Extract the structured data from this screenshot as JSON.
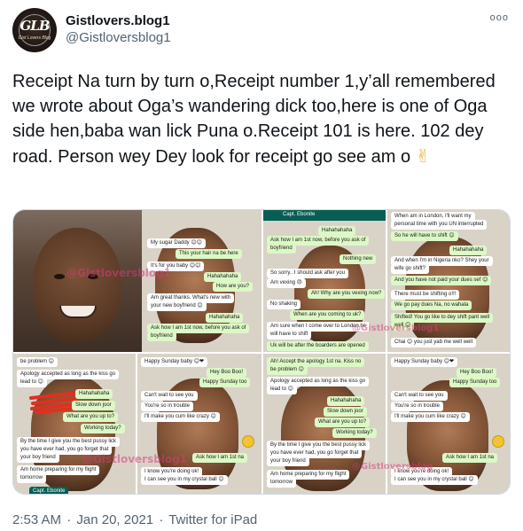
{
  "account": {
    "display_name": "Gistlovers.blog1",
    "handle": "@Gistloversblog1",
    "avatar_monogram": "GLB",
    "avatar_subtext": "Gist Lovers Blog"
  },
  "more_label": "ooo",
  "tweet_text": "Receipt Na turn by turn o,Receipt number 1,y’all remembered we wrote about Oga’s wandering dick too,here is one of Oga side hen,baba wan lick Puna o.Receipt 101 is here. 102 dey road. Person wey Dey look for receipt go see am o",
  "tweet_emoji": "✌",
  "media": {
    "watermark": "@Gistloversblog1",
    "watermark_alt": "@Gistloversblog",
    "panels": [
      {
        "name": "panel-1",
        "messages": [
          {
            "text": "My sugar Daddy 😊😊",
            "side": "recv"
          },
          {
            "text": "This your hair na be here",
            "side": "sent"
          },
          {
            "text": "It's for you baby 😊😊",
            "side": "recv"
          },
          {
            "text": "Hahahahaha",
            "side": "sent"
          },
          {
            "text": "How are you?",
            "side": "sent"
          },
          {
            "text": "Am great thanks. What's new with",
            "side": "recv"
          },
          {
            "text": "your new boyfriend 😊",
            "side": "recv"
          },
          {
            "text": "Hahahahaha",
            "side": "sent"
          },
          {
            "text": "Ask how I am 1st now, before you ask of",
            "side": "sent"
          },
          {
            "text": "boyfriend",
            "side": "sent"
          }
        ]
      },
      {
        "name": "panel-2",
        "contact": "Capt. Ebonite",
        "messages": [
          {
            "text": "Hahahahaha",
            "side": "sent"
          },
          {
            "text": "Ask how I am 1st now, before you ask of",
            "side": "sent"
          },
          {
            "text": "boyfriend",
            "side": "sent"
          },
          {
            "text": "Nothing new",
            "side": "sent"
          },
          {
            "text": "So sorry.. I should ask after you",
            "side": "recv"
          },
          {
            "text": "Am vexing 😠",
            "side": "recv"
          },
          {
            "text": "Ah! Why are you vexing now?",
            "side": "sent"
          },
          {
            "text": "No shaking",
            "side": "recv"
          },
          {
            "text": "When are you coming to uk?",
            "side": "sent"
          },
          {
            "text": "Am sure when I come over to London he",
            "side": "recv"
          },
          {
            "text": "will have to shift",
            "side": "recv"
          },
          {
            "text": "Uk will be after the boarders are opened",
            "side": "sent"
          },
          {
            "text": "When am in London, I'll want my",
            "side": "recv"
          },
          {
            "text": "personal time with you UN interrupted",
            "side": "recv"
          },
          {
            "text": "So he will have to shift 😊",
            "side": "sent"
          },
          {
            "text": "Hahahahaha",
            "side": "sent"
          },
          {
            "text": "And when I'm in Nigeria nko? Shey your",
            "side": "recv"
          },
          {
            "text": "wife go shift?",
            "side": "recv"
          },
          {
            "text": "And you have not paid your dues sef 😊",
            "side": "sent"
          },
          {
            "text": "There must be shifting o!!!",
            "side": "recv"
          },
          {
            "text": "We go pay dues Na, no wahala",
            "side": "sent"
          },
          {
            "text": "Shifted! You go like to dey shift pant well",
            "side": "sent"
          },
          {
            "text": "well 😊",
            "side": "sent"
          },
          {
            "text": "Chai 😊 you just yab me well well",
            "side": "recv"
          }
        ]
      },
      {
        "name": "panel-3",
        "messages": [
          {
            "text": "be problem 😊",
            "side": "recv"
          },
          {
            "text": "Apology accepted as long as the kiss go",
            "side": "recv"
          },
          {
            "text": "lead to 😊",
            "side": "recv"
          },
          {
            "text": "Hahahahaha",
            "side": "sent"
          },
          {
            "text": "Slow down joor",
            "side": "sent"
          },
          {
            "text": "What are you up to?",
            "side": "sent"
          },
          {
            "text": "Working today?",
            "side": "sent"
          },
          {
            "text": "By the time I give you the best pussy lick",
            "side": "recv"
          },
          {
            "text": "you have ever had, you go forget that",
            "side": "recv"
          },
          {
            "text": "your boy friend",
            "side": "recv"
          },
          {
            "text": "Am home preparing for my flight",
            "side": "recv"
          },
          {
            "text": "tomorrow",
            "side": "recv"
          },
          {
            "text": "Capt. Ebonite",
            "side": "recv"
          },
          {
            "text": "Happy Sunday baby 😊❤",
            "side": "recv"
          },
          {
            "text": "Hey Boo Boo!",
            "side": "sent"
          },
          {
            "text": "Happy Sunday too",
            "side": "sent"
          },
          {
            "text": "Can't wait to see you",
            "side": "recv"
          },
          {
            "text": "You're so in trouble",
            "side": "recv"
          },
          {
            "text": "I'll make you cum like crazy 😊",
            "side": "recv"
          },
          {
            "text": "Ask how I am 1st na",
            "side": "sent"
          },
          {
            "text": "I know you're doing ok!",
            "side": "recv"
          },
          {
            "text": "I can see you in my crystal ball 😊",
            "side": "recv"
          }
        ]
      },
      {
        "name": "panel-4",
        "messages": [
          {
            "text": "Ah! Accept the apology 1st na. Kiss no",
            "side": "sent"
          },
          {
            "text": "be problem 😊",
            "side": "sent"
          },
          {
            "text": "Apology accepted as long as the kiss go",
            "side": "recv"
          },
          {
            "text": "lead to 😊",
            "side": "recv"
          },
          {
            "text": "Hahahahaha",
            "side": "sent"
          },
          {
            "text": "Slow down joor",
            "side": "sent"
          },
          {
            "text": "What are you up to?",
            "side": "sent"
          },
          {
            "text": "Working today?",
            "side": "sent"
          },
          {
            "text": "By the time I give you the best pussy lick",
            "side": "recv"
          },
          {
            "text": "you have ever had, you go forget that",
            "side": "recv"
          },
          {
            "text": "your boy friend",
            "side": "recv"
          },
          {
            "text": "Am home preparing for my flight",
            "side": "recv"
          },
          {
            "text": "tomorrow",
            "side": "recv"
          },
          {
            "text": "Happy Sunday baby 😊❤",
            "side": "recv"
          },
          {
            "text": "Hey Boo Boo!",
            "side": "sent"
          },
          {
            "text": "Happy Sunday too",
            "side": "sent"
          },
          {
            "text": "Can't wait to see you",
            "side": "recv"
          },
          {
            "text": "You're so in trouble",
            "side": "recv"
          },
          {
            "text": "I'll make you cum like crazy 😊",
            "side": "recv"
          },
          {
            "text": "Ask how I am 1st na",
            "side": "sent"
          },
          {
            "text": "I know you're doing ok!",
            "side": "recv"
          },
          {
            "text": "I can see you in my crystal ball 😊",
            "side": "recv"
          }
        ]
      }
    ]
  },
  "meta": {
    "time": "2:53 AM",
    "date": "Jan 20, 2021",
    "separator": "·",
    "source": "Twitter for iPad"
  },
  "colors": {
    "text": "#0f1419",
    "secondary": "#536471",
    "sent_bubble": "#dcf8c6",
    "recv_bubble": "#ffffff",
    "chat_background": "#d9d2c7",
    "whatsapp_header": "#075e54",
    "watermark": "#d73c78"
  }
}
